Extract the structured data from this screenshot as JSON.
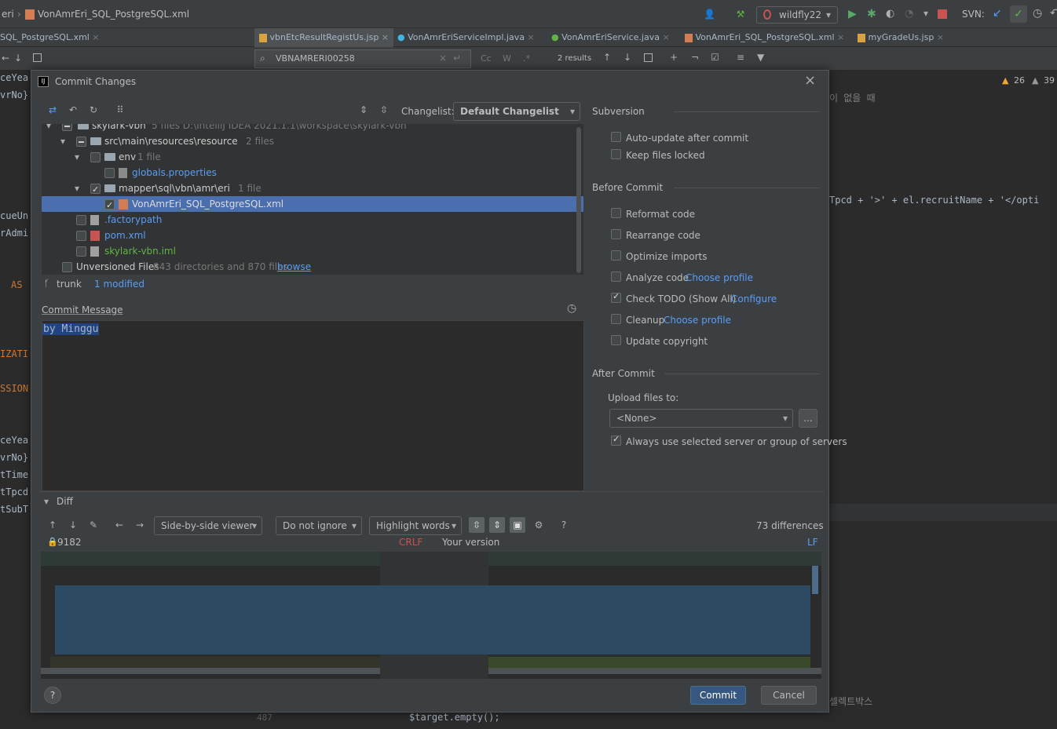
{
  "topbar": {
    "breadcrumb_left": "eri",
    "breadcrumb_file": "VonAmrEri_SQL_PostgreSQL.xml",
    "run_config": "wildfly22",
    "svn_label": "SVN:"
  },
  "editor_tabs": [
    {
      "label": "SQL_PostgreSQL.xml"
    },
    {
      "label": "vbnEtcResultRegistUs.jsp"
    },
    {
      "label": "VonAmrEriServiceImpl.java"
    },
    {
      "label": "VonAmrEriService.java"
    },
    {
      "label": "VonAmrEri_SQL_PostgreSQL.xml"
    },
    {
      "label": "myGradeUs.jsp"
    }
  ],
  "search_bar": {
    "query": "VBNAMRERI00258",
    "case_label": "Cc",
    "words_label": "W",
    "regex_label": ".*",
    "results": "2 results"
  },
  "right_panel": {
    "warnings": "26",
    "weak_warnings": "39",
    "korean_text": "이 없을 때",
    "code_line": "Tpcd + '>' + el.recruitName + '</opti",
    "korean_bottom": "셀렉트박스"
  },
  "bottom_code": {
    "line_number": "487",
    "code": "$target.empty();"
  },
  "left_code": [
    "ceYea",
    "vrNo}",
    "cueUn",
    "rAdmi",
    "AS",
    "IZATI",
    "SSION",
    "ceYea",
    "vrNo}",
    "tTime",
    "tTpcd",
    "tSubT"
  ],
  "dialog": {
    "title": "Commit Changes",
    "changelist_label": "Changelist:",
    "changelist_value": "Default Changelist",
    "tree": [
      {
        "label": "skylark-vbn",
        "meta": "5 files  D:\\IntelliJ IDEA 2021.1.1\\workspace\\skylark-vbn",
        "level": 0,
        "check": "part"
      },
      {
        "label": "src\\main\\resources\\resource",
        "meta": "2 files",
        "level": 1,
        "check": "part"
      },
      {
        "label": "env",
        "meta": "1 file",
        "level": 2,
        "check": "off"
      },
      {
        "label": "globals.properties",
        "meta": "",
        "level": 3,
        "check": "off"
      },
      {
        "label": "mapper\\sql\\vbn\\amr\\eri",
        "meta": "1 file",
        "level": 2,
        "check": "on"
      },
      {
        "label": "VonAmrEri_SQL_PostgreSQL.xml",
        "meta": "",
        "level": 3,
        "check": "on"
      },
      {
        "label": ".factorypath",
        "meta": "",
        "level": 1,
        "check": "off"
      },
      {
        "label": "pom.xml",
        "meta": "",
        "level": 1,
        "check": "off"
      },
      {
        "label": "skylark-vbn.iml",
        "meta": "",
        "level": 1,
        "check": "off"
      }
    ],
    "unversioned_label": "Unversioned Files",
    "unversioned_meta": "843 directories and 870 files",
    "unversioned_link": "browse",
    "branch": "trunk",
    "modified": "1 modified",
    "commit_message_label": "Commit Message",
    "commit_message": "by Minggu",
    "subversion": {
      "title": "Subversion",
      "options": [
        {
          "label": "Auto-update after commit",
          "checked": false
        },
        {
          "label": "Keep files locked",
          "checked": false
        }
      ]
    },
    "before_commit": {
      "title": "Before Commit",
      "options": [
        {
          "label": "Reformat code",
          "link": "",
          "checked": false
        },
        {
          "label": "Rearrange code",
          "link": "",
          "checked": false
        },
        {
          "label": "Optimize imports",
          "link": "",
          "checked": false
        },
        {
          "label": "Analyze code",
          "link": "Choose profile",
          "checked": false
        },
        {
          "label": "Check TODO (Show All)",
          "link": "Configure",
          "checked": true
        },
        {
          "label": "Cleanup",
          "link": "Choose profile",
          "checked": false
        },
        {
          "label": "Update copyright",
          "link": "",
          "checked": false
        }
      ]
    },
    "after_commit": {
      "title": "After Commit",
      "upload_label": "Upload files to:",
      "upload_value": "<None>",
      "browse_label": "...",
      "always_label": "Always use selected server or group of servers"
    },
    "diff": {
      "title": "Diff",
      "viewer": "Side-by-side viewer",
      "ignore": "Do not ignore",
      "highlight": "Highlight words",
      "differences": "73 differences",
      "left_rev": "9182",
      "left_sep": "CRLF",
      "right_title": "Your version",
      "right_sep": "LF"
    },
    "help_label": "?",
    "commit_button": "Commit",
    "cancel_button": "Cancel"
  },
  "colors": {
    "selection": "#4b6eaf",
    "link": "#589df6",
    "primary_button": "#365880"
  }
}
